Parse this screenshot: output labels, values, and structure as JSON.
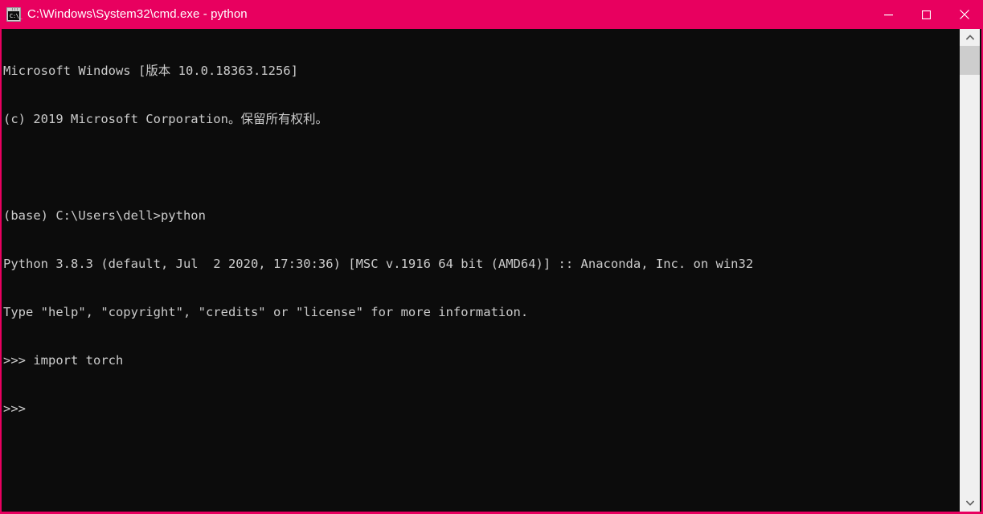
{
  "window": {
    "title": "C:\\Windows\\System32\\cmd.exe - python",
    "icon_name": "cmd-console-icon",
    "icon_glyph": "C:\\_",
    "titlebar_color": "#E8005F",
    "console_bg": "#0C0C0C",
    "console_fg": "#CCCCCC",
    "controls": {
      "minimize_label": "Minimize",
      "maximize_label": "Maximize",
      "close_label": "Close"
    }
  },
  "console": {
    "lines": [
      "Microsoft Windows [版本 10.0.18363.1256]",
      "(c) 2019 Microsoft Corporation。保留所有权利。",
      "",
      "(base) C:\\Users\\dell>python",
      "Python 3.8.3 (default, Jul  2 2020, 17:30:36) [MSC v.1916 64 bit (AMD64)] :: Anaconda, Inc. on win32",
      "Type \"help\", \"copyright\", \"credits\" or \"license\" for more information.",
      ">>> import torch",
      ">>>"
    ],
    "prompt": ">>>",
    "last_command": "import torch",
    "shell_prompt": "(base) C:\\Users\\dell>",
    "shell_command": "python"
  },
  "scrollbar": {
    "up_arrow_name": "scroll-up-arrow",
    "down_arrow_name": "scroll-down-arrow",
    "thumb_name": "scrollbar-thumb",
    "track_color": "#F0F0F0",
    "thumb_color": "#CDCDCD"
  }
}
